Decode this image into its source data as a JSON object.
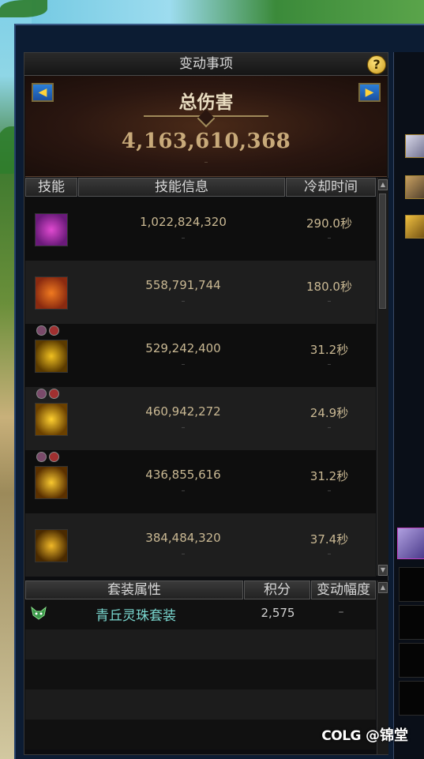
{
  "panel": {
    "title": "变动事项",
    "help_label": "?"
  },
  "damage": {
    "title": "总伤害",
    "value": "4,163,610,368",
    "sub": "–",
    "prev_label": "◀",
    "next_label": "▶"
  },
  "skill_table": {
    "headers": [
      "技能",
      "技能信息",
      "冷却时间"
    ],
    "rows": [
      {
        "value": "1,022,824,320",
        "cooldown": "290.0秒",
        "icon": "demon-mask-skill-icon",
        "icon_colors": [
          "#6a1a7a",
          "#e04ad0"
        ],
        "buffs": []
      },
      {
        "value": "558,791,744",
        "cooldown": "180.0秒",
        "icon": "fire-beast-skill-icon",
        "icon_colors": [
          "#8a2a10",
          "#f07a20"
        ],
        "buffs": []
      },
      {
        "value": "529,242,400",
        "cooldown": "31.2秒",
        "icon": "light-burst-skill-icon",
        "icon_colors": [
          "#5a3a00",
          "#f0c020"
        ],
        "buffs": [
          "rune-buff-icon",
          "swirl-buff-icon"
        ]
      },
      {
        "value": "460,942,272",
        "cooldown": "24.9秒",
        "icon": "spark-burst-skill-icon",
        "icon_colors": [
          "#6a4000",
          "#ffd030"
        ],
        "buffs": [
          "rune-buff-icon",
          "swirl-buff-icon"
        ]
      },
      {
        "value": "436,855,616",
        "cooldown": "31.2秒",
        "icon": "radiant-orb-skill-icon",
        "icon_colors": [
          "#5a3000",
          "#f8c830"
        ],
        "buffs": [
          "rune-buff-icon",
          "swirl-buff-icon"
        ]
      },
      {
        "value": "384,484,320",
        "cooldown": "37.4秒",
        "icon": "star-blast-skill-icon",
        "icon_colors": [
          "#4a2a00",
          "#f0b828"
        ],
        "buffs": []
      }
    ],
    "sub_dash": "–"
  },
  "set_table": {
    "headers": [
      "套装属性",
      "积分",
      "变动幅度"
    ],
    "rows": [
      {
        "name": "青丘灵珠套装",
        "score": "2,575",
        "change": "–",
        "icon": "fox-set-icon"
      }
    ]
  },
  "watermark": {
    "logo": "COLG",
    "text": "@锦堂"
  },
  "colors": {
    "accent_blue": "#1a4fa0",
    "gold_text": "#c8aa7a",
    "set_name": "#7ad8d0"
  }
}
